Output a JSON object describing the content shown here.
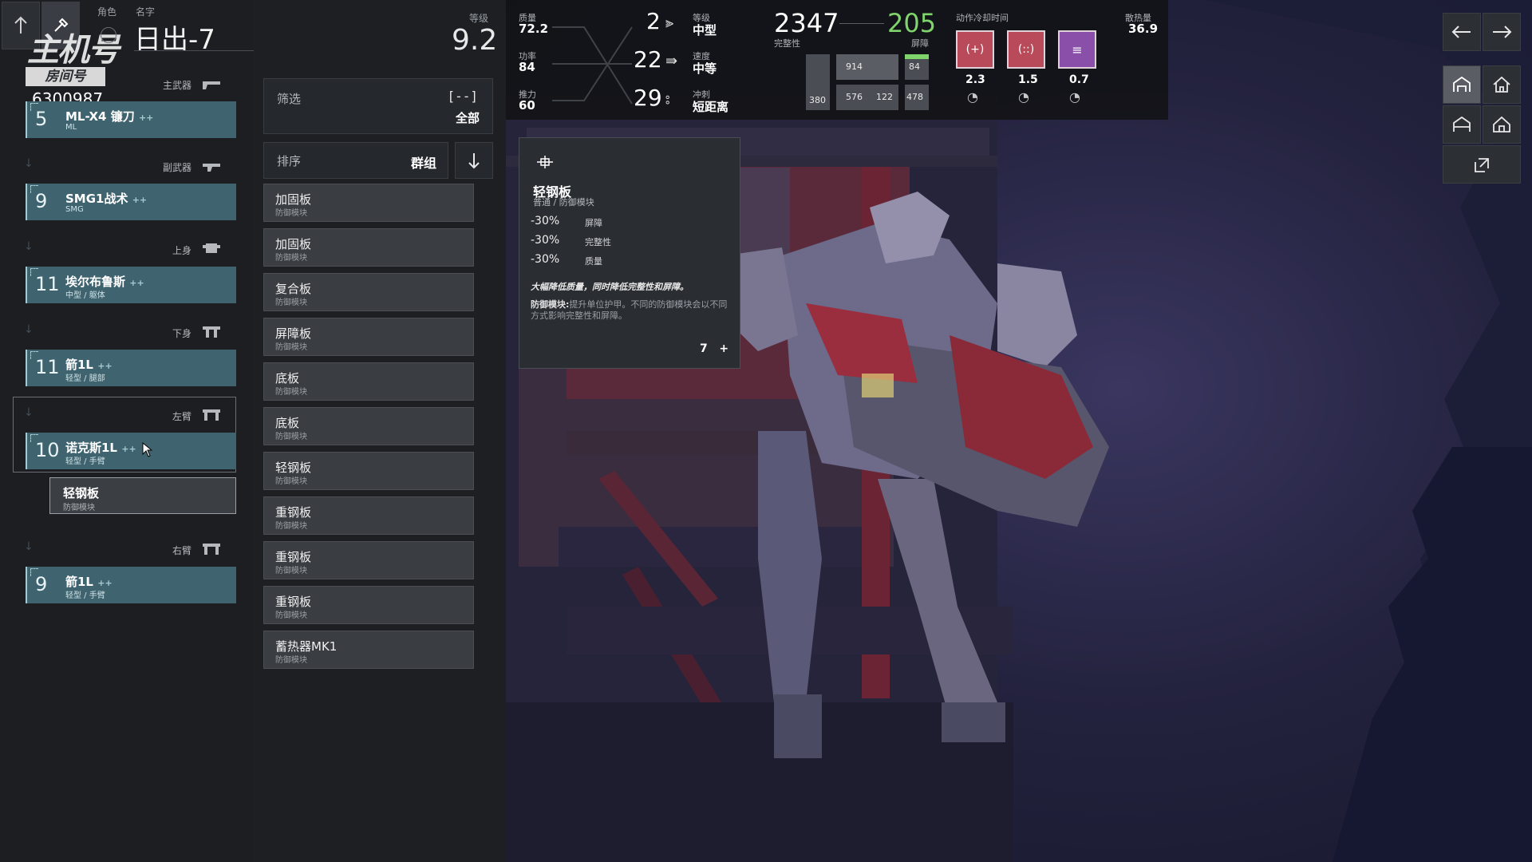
{
  "header": {
    "role_label": "角色",
    "name_label": "名字",
    "name": "日出-7",
    "level_label": "等级",
    "level_value": "9.2",
    "logo_text": "主机号",
    "room_label": "房间号",
    "room_number": "6300987"
  },
  "slots": [
    {
      "category": "主武器",
      "level": "5",
      "name": "ML-X4 镰刀",
      "plus": "++",
      "sub": "ML"
    },
    {
      "category": "副武器",
      "level": "9",
      "name": "SMG1战术",
      "plus": "++",
      "sub": "SMG"
    },
    {
      "category": "上身",
      "level": "11",
      "name": "埃尔布鲁斯",
      "plus": "++",
      "sub": "中型 / 躯体"
    },
    {
      "category": "下身",
      "level": "11",
      "name": "箭1L",
      "plus": "++",
      "sub": "轻型 / 腿部"
    },
    {
      "category": "左臂",
      "level": "10",
      "name": "诺克斯1L",
      "plus": "++",
      "sub": "轻型 / 手臂"
    },
    {
      "category": "右臂",
      "level": "9",
      "name": "箭1L",
      "plus": "++",
      "sub": "轻型 / 手臂"
    }
  ],
  "equipped_module": {
    "name": "轻钢板",
    "sub": "防御模块"
  },
  "filter": {
    "label": "筛选",
    "icon_text": "[--]",
    "value": "全部"
  },
  "sort": {
    "label": "排序",
    "value": "群组"
  },
  "module_list": [
    {
      "name": "加固板",
      "sub": "防御模块"
    },
    {
      "name": "加固板",
      "sub": "防御模块"
    },
    {
      "name": "复合板",
      "sub": "防御模块"
    },
    {
      "name": "屏障板",
      "sub": "防御模块"
    },
    {
      "name": "底板",
      "sub": "防御模块"
    },
    {
      "name": "底板",
      "sub": "防御模块"
    },
    {
      "name": "轻钢板",
      "sub": "防御模块"
    },
    {
      "name": "重钢板",
      "sub": "防御模块"
    },
    {
      "name": "重钢板",
      "sub": "防御模块"
    },
    {
      "name": "重钢板",
      "sub": "防御模块"
    },
    {
      "name": "蓄热器MK1",
      "sub": "防御模块"
    }
  ],
  "stats": {
    "mass_label": "质量",
    "mass": "72.2",
    "power_label": "功率",
    "power": "84",
    "thrust_label": "推力",
    "thrust": "60",
    "weight_val": "2",
    "speed_val": "22",
    "dash_val": "29",
    "class_label": "等级",
    "class_value": "中型",
    "speed_label": "速度",
    "speed_value": "中等",
    "dash_label": "冲刺",
    "dash_value": "短距离",
    "integrity": "2347",
    "integrity_label": "完整性",
    "shield": "205",
    "shield_label": "屏障",
    "bar_914": "914",
    "bar_84": "84",
    "bar_380": "380",
    "bar_576": "576",
    "bar_122": "122",
    "bar_478": "478",
    "cooldown_label": "动作冷却时间",
    "cooldowns": [
      "2.3",
      "1.5",
      "0.7"
    ],
    "heat_label": "散热量",
    "heat": "36.9"
  },
  "tooltip": {
    "title": "轻钢板",
    "subtitle": "普通 / 防御模块",
    "rows": [
      {
        "pct": "-30%",
        "stat": "屏障"
      },
      {
        "pct": "-30%",
        "stat": "完整性"
      },
      {
        "pct": "-30%",
        "stat": "质量"
      }
    ],
    "desc": "大幅降低质量，同时降低完整性和屏障。",
    "note_label": "防御模块:",
    "note": "提升单位护甲。不同的防御模块会以不同方式影响完整性和屏障。",
    "count": "7",
    "count_plus": "+"
  },
  "colors": {
    "slot_card": "#3f6470",
    "shield_green": "#7fd46b",
    "cd_red": "#b84a5a",
    "cd_purple": "#8a4fa8"
  }
}
